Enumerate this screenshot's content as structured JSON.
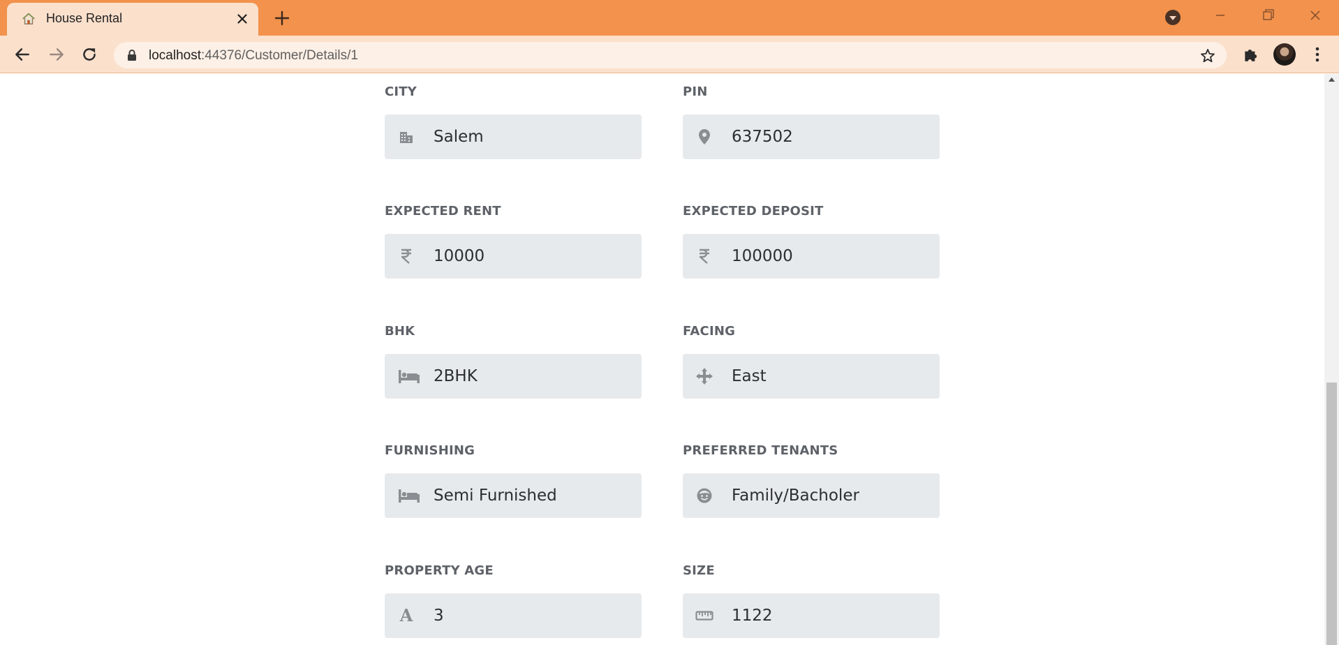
{
  "browser": {
    "tab_title": "House Rental",
    "url_host": "localhost",
    "url_rest": ":44376/Customer/Details/1",
    "accent_color": "#f2924c"
  },
  "form": {
    "fields": [
      {
        "label": "CITY",
        "value": "Salem",
        "icon": "city-icon"
      },
      {
        "label": "PIN",
        "value": "637502",
        "icon": "map-pin-icon"
      },
      {
        "label": "EXPECTED RENT",
        "value": "10000",
        "icon": "rupee-icon"
      },
      {
        "label": "EXPECTED DEPOSIT",
        "value": "100000",
        "icon": "rupee-icon"
      },
      {
        "label": "BHK",
        "value": "2BHK",
        "icon": "bed-icon"
      },
      {
        "label": "FACING",
        "value": "East",
        "icon": "compass-arrows-icon"
      },
      {
        "label": "FURNISHING",
        "value": "Semi Furnished",
        "icon": "bed-icon"
      },
      {
        "label": "PREFERRED TENANTS",
        "value": "Family/Bacholer",
        "icon": "smile-face-icon"
      },
      {
        "label": "PROPERTY AGE",
        "value": "3",
        "icon": "font-a-icon"
      },
      {
        "label": "SIZE",
        "value": "1122",
        "icon": "ruler-icon"
      }
    ],
    "property_age_icon_text": "A"
  }
}
